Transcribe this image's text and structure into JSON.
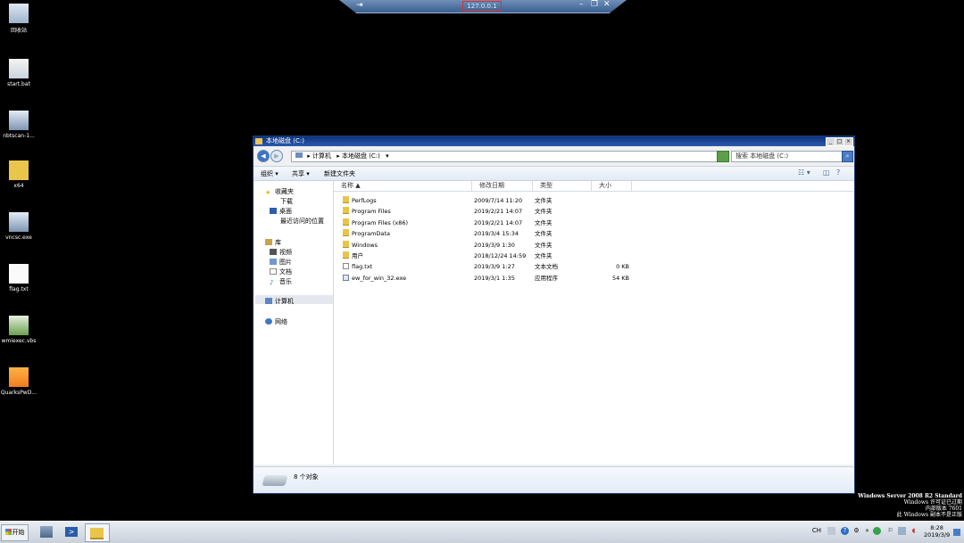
{
  "remote": {
    "host": "127.0.0.1",
    "pin_glyph": "⇥",
    "min_glyph": "–",
    "restore_glyph": "❐",
    "close_glyph": "✕"
  },
  "desktop_icons": [
    {
      "label": "回收站",
      "icon": "recycle-bin-icon"
    },
    {
      "label": "start.bat",
      "icon": "batch-file-icon"
    },
    {
      "label": "nbtscan-1...",
      "icon": "exe-file-icon"
    },
    {
      "label": "x64",
      "icon": "folder-icon"
    },
    {
      "label": "vncsc.exe",
      "icon": "exe-file-icon"
    },
    {
      "label": "flag.txt",
      "icon": "text-file-icon"
    },
    {
      "label": "wmiexec.vbs",
      "icon": "script-file-icon"
    },
    {
      "label": "QuarksPwD...",
      "icon": "lock-icon"
    }
  ],
  "window": {
    "title": "本地磁盘 (C:)",
    "address": {
      "crumbs": [
        "计算机",
        "本地磁盘 (C:)"
      ],
      "sep": "▸",
      "dropdown": "▾"
    },
    "search_placeholder": "搜索 本地磁盘 (C:)",
    "toolbar": {
      "organize": "组织 ▾",
      "share": "共享 ▾",
      "new_folder": "新建文件夹"
    },
    "nav": {
      "favorites": "收藏夹",
      "downloads": "下载",
      "desktop": "桌面",
      "recent": "最近访问的位置",
      "libraries": "库",
      "videos": "视频",
      "pictures": "图片",
      "documents": "文档",
      "music": "音乐",
      "computer": "计算机",
      "network": "网络"
    },
    "columns": {
      "name": "名称 ▲",
      "modified": "修改日期",
      "type": "类型",
      "size": "大小"
    },
    "files": [
      {
        "name": "PerfLogs",
        "modified": "2009/7/14 11:20",
        "type": "文件夹",
        "size": "",
        "kind": "folder"
      },
      {
        "name": "Program Files",
        "modified": "2019/2/21 14:07",
        "type": "文件夹",
        "size": "",
        "kind": "folder"
      },
      {
        "name": "Program Files (x86)",
        "modified": "2019/2/21 14:07",
        "type": "文件夹",
        "size": "",
        "kind": "folder"
      },
      {
        "name": "ProgramData",
        "modified": "2019/3/4 15:34",
        "type": "文件夹",
        "size": "",
        "kind": "folder"
      },
      {
        "name": "Windows",
        "modified": "2019/3/9 1:30",
        "type": "文件夹",
        "size": "",
        "kind": "folder"
      },
      {
        "name": "用户",
        "modified": "2018/12/24 14:59",
        "type": "文件夹",
        "size": "",
        "kind": "folder"
      },
      {
        "name": "flag.txt",
        "modified": "2019/3/9 1:27",
        "type": "文本文档",
        "size": "0 KB",
        "kind": "txt"
      },
      {
        "name": "ew_for_win_32.exe",
        "modified": "2019/3/1 1:35",
        "type": "应用程序",
        "size": "54 KB",
        "kind": "exe"
      }
    ],
    "status": "8 个对象"
  },
  "watermark": {
    "line1": "Windows Server 2008 R2 Standard",
    "line2": "Windows 许可证已过期",
    "line3": "内部版本 7601",
    "line4": "此 Windows 副本不是正版"
  },
  "taskbar": {
    "start_label": "开始",
    "tray_lang": "CH",
    "clock_time": "8:28",
    "clock_date": "2019/3/9"
  }
}
